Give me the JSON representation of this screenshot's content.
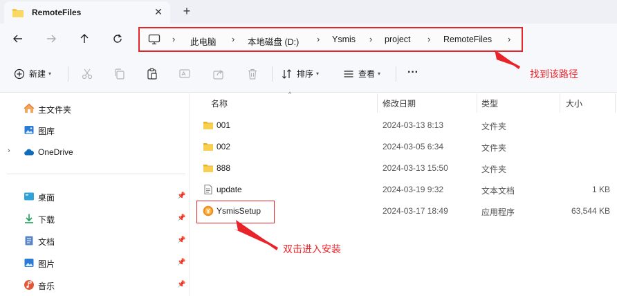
{
  "window": {
    "tab_title": "RemoteFiles",
    "close_glyph": "✕",
    "new_tab_glyph": "+"
  },
  "breadcrumb": [
    "此电脑",
    "本地磁盘 (D:)",
    "Ysmis",
    "project",
    "RemoteFiles"
  ],
  "commands": {
    "new_label": "新建",
    "sort_label": "排序",
    "view_label": "查看",
    "more_label": "···"
  },
  "sidebar": {
    "top_items": [
      {
        "label": "主文件夹",
        "icon": "home-icon"
      },
      {
        "label": "图库",
        "icon": "gallery-icon"
      },
      {
        "label": "OneDrive",
        "icon": "onedrive-icon"
      }
    ],
    "pinned_items": [
      {
        "label": "桌面",
        "icon": "desktop-icon"
      },
      {
        "label": "下载",
        "icon": "download-icon"
      },
      {
        "label": "文档",
        "icon": "document-icon"
      },
      {
        "label": "图片",
        "icon": "picture-icon"
      },
      {
        "label": "音乐",
        "icon": "music-icon"
      }
    ]
  },
  "columns": {
    "name": "名称",
    "date": "修改日期",
    "type": "类型",
    "size": "大小"
  },
  "files": [
    {
      "name": "001",
      "date": "2024-03-13 8:13",
      "type": "文件夹",
      "size": "",
      "icon": "folder-icon"
    },
    {
      "name": "002",
      "date": "2024-03-05 6:34",
      "type": "文件夹",
      "size": "",
      "icon": "folder-icon"
    },
    {
      "name": "888",
      "date": "2024-03-13 15:50",
      "type": "文件夹",
      "size": "",
      "icon": "folder-icon"
    },
    {
      "name": "update",
      "date": "2024-03-19 9:32",
      "type": "文本文档",
      "size": "1 KB",
      "icon": "text-file-icon"
    },
    {
      "name": "YsmisSetup",
      "date": "2024-03-17 18:49",
      "type": "应用程序",
      "size": "63,544 KB",
      "icon": "setup-app-icon"
    }
  ],
  "annotations": {
    "path_note": "找到该路径",
    "install_note": "双击进入安装"
  },
  "colors": {
    "annotation": "#e8242a",
    "folder": "#f4c542",
    "accent": "#0067c0"
  }
}
